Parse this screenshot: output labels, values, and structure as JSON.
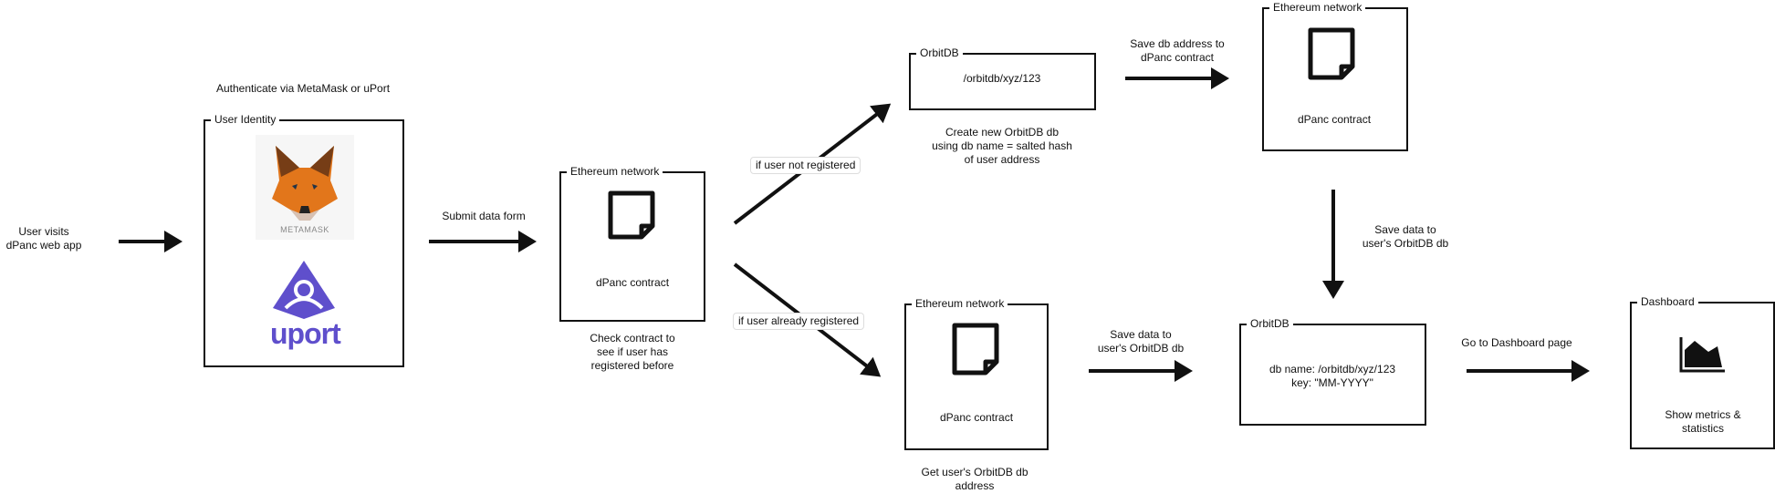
{
  "start": {
    "text_line1": "User visits",
    "text_line2": "dPanc web app"
  },
  "auth": {
    "caption": "Authenticate via MetaMask or uPort",
    "box_title": "User Identity",
    "metamask_label": "METAMASK",
    "uport_label": "uport",
    "uport_color": "#5f4fcc",
    "metamask_color": "#e2761b"
  },
  "submit": {
    "label": "Submit data form"
  },
  "eth_check": {
    "box_title": "Ethereum network",
    "contract_label": "dPanc contract",
    "caption_lines": [
      "Check contract to",
      "see if user has",
      "registered before"
    ]
  },
  "branch": {
    "not_registered": "if user not registered",
    "already_registered": "if user already registered"
  },
  "orbit_new": {
    "box_title": "OrbitDB",
    "address": "/orbitdb/xyz/123",
    "caption_lines": [
      "Create new OrbitDB db",
      "using db name = salted hash",
      "of user address"
    ]
  },
  "save_address": {
    "label_lines": [
      "Save db address to",
      "dPanc contract"
    ]
  },
  "eth_save": {
    "box_title": "Ethereum network",
    "contract_label": "dPanc contract"
  },
  "save_data_vertical": {
    "label_lines": [
      "Save data to",
      "user's OrbitDB db"
    ]
  },
  "eth_get": {
    "box_title": "Ethereum network",
    "contract_label": "dPanc contract",
    "caption_lines": [
      "Get user's OrbitDB db",
      "address"
    ]
  },
  "save_data_horizontal": {
    "label_lines": [
      "Save data to",
      "user's OrbitDB db"
    ]
  },
  "orbit_store": {
    "box_title": "OrbitDB",
    "line1": "db name: /orbitdb/xyz/123",
    "line2": "key: \"MM-YYYY\""
  },
  "goto_dashboard": {
    "label": "Go to Dashboard page"
  },
  "dashboard": {
    "box_title": "Dashboard",
    "caption_lines": [
      "Show metrics &",
      "statistics"
    ]
  }
}
